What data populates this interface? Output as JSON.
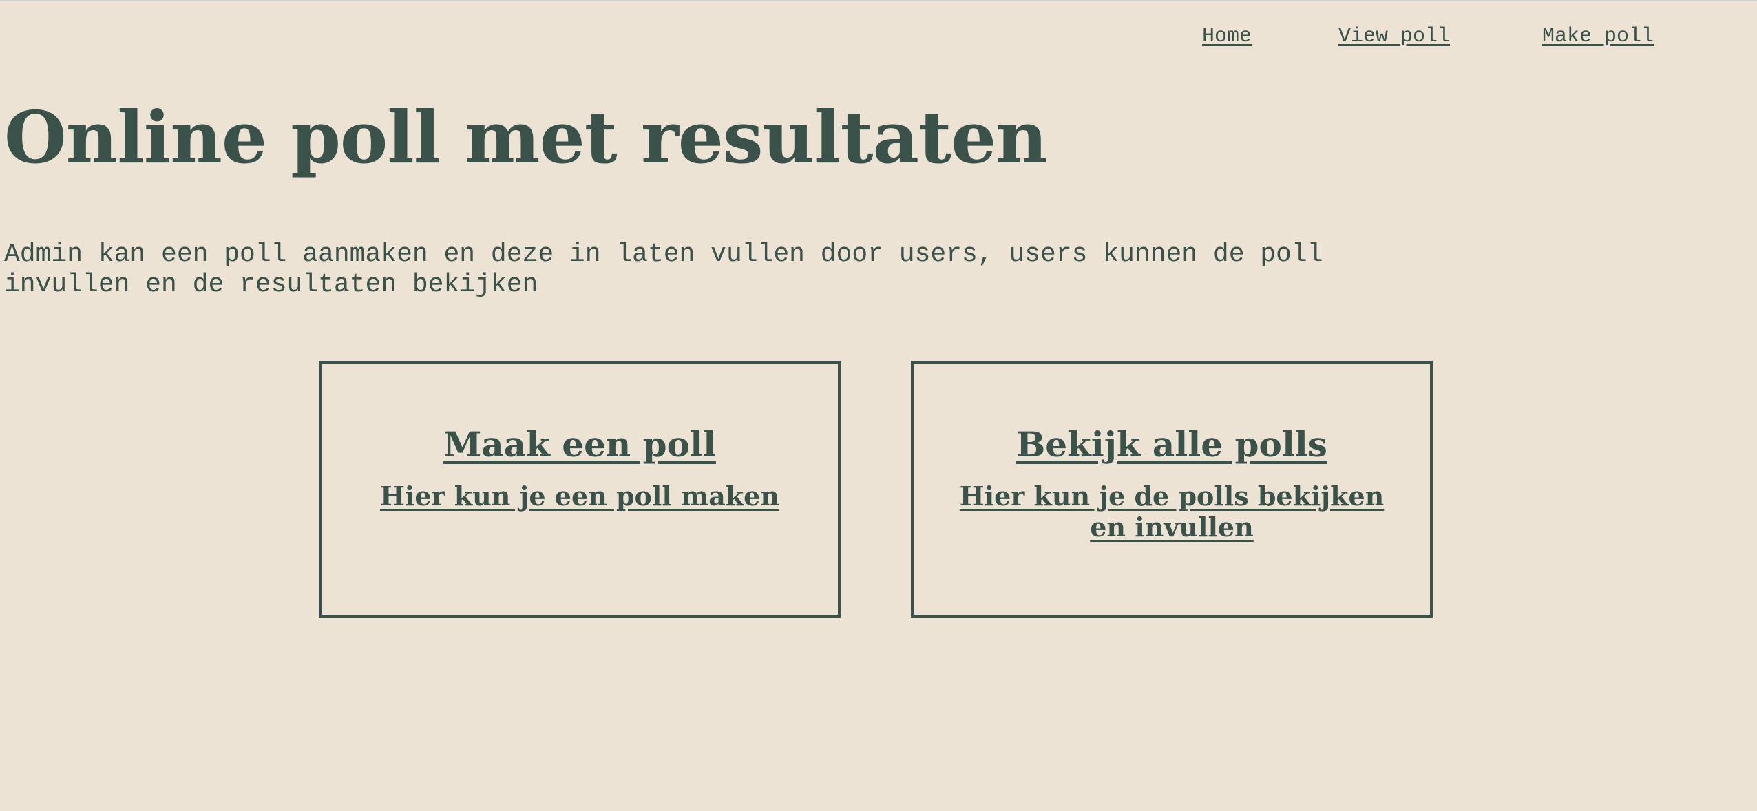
{
  "nav": {
    "home": "Home",
    "view_poll": "View poll",
    "make_poll": "Make poll"
  },
  "hero": {
    "title": "Online poll met resultaten",
    "description": "Admin kan een poll aanmaken en deze in laten vullen door users, users kunnen de poll invullen en de resultaten bekijken"
  },
  "cards": [
    {
      "title": "Maak een poll",
      "text": "Hier kun je een poll maken"
    },
    {
      "title": "Bekijk alle polls",
      "text": "Hier kun je de polls bekijken en invullen"
    }
  ],
  "colors": {
    "background": "#ece3d4",
    "text": "#3a524a"
  }
}
